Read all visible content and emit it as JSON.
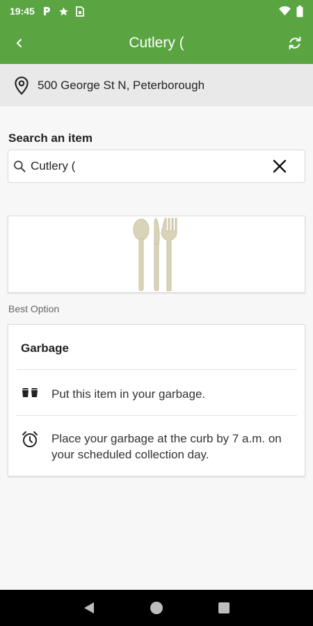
{
  "status_bar": {
    "time": "19:45",
    "left_icons": [
      "parking-icon",
      "star-icon",
      "sim-card-icon"
    ],
    "right_icons": [
      "wifi-icon",
      "battery-icon"
    ]
  },
  "app_bar": {
    "title": "Cutlery (",
    "back_icon": "chevron-left-icon",
    "refresh_icon": "refresh-icon"
  },
  "address": {
    "icon": "location-pin-icon",
    "text": "500 George St N, Peterborough"
  },
  "search": {
    "label": "Search an item",
    "value": "Cutlery (",
    "search_icon": "search-icon",
    "clear_icon": "close-icon"
  },
  "item_image": {
    "icon": "cutlery-icon"
  },
  "best_option": {
    "label": "Best Option",
    "title": "Garbage",
    "rows": [
      {
        "icon": "garbage-bins-icon",
        "text": "Put this item in your garbage."
      },
      {
        "icon": "alarm-clock-icon",
        "text": "Place your garbage at the curb by 7 a.m. on your scheduled collection day."
      }
    ]
  },
  "nav_bar": {
    "back_icon": "nav-back-icon",
    "home_icon": "nav-home-icon",
    "recents_icon": "nav-recents-icon"
  },
  "colors": {
    "primary": "#5aa542",
    "address_bg": "#e9e9e9",
    "page_bg": "#f7f7f7",
    "utensil": "#d9d3b8"
  }
}
